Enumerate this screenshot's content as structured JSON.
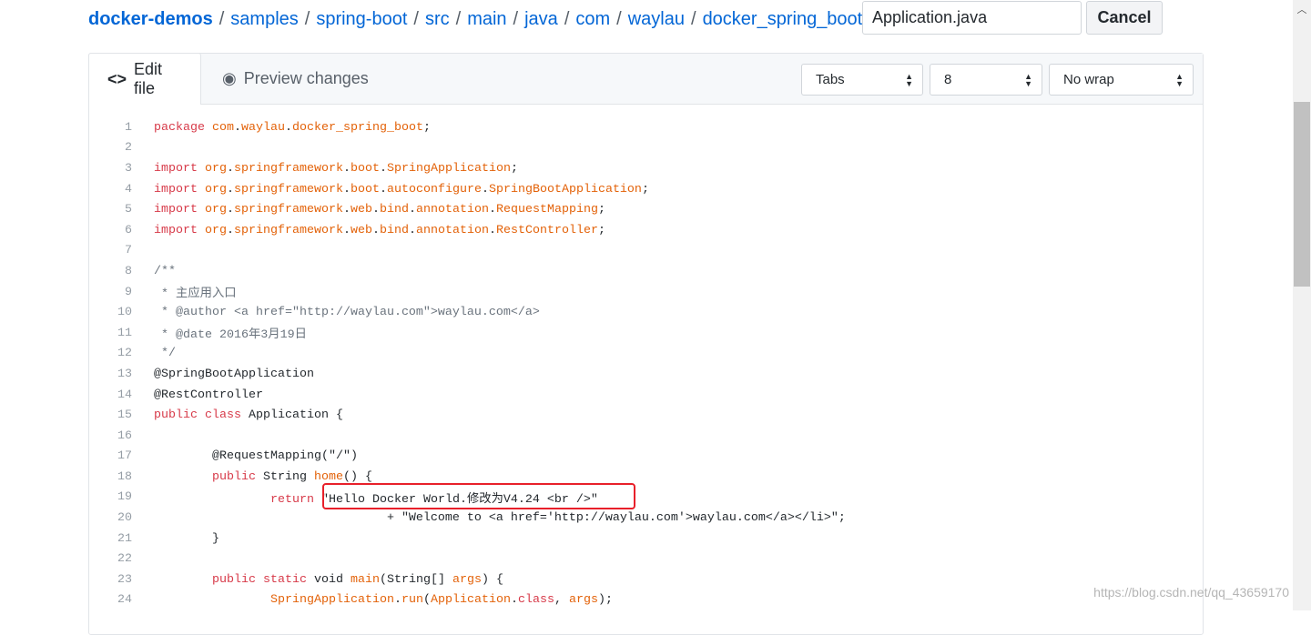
{
  "breadcrumb": [
    "docker-demos",
    "samples",
    "spring-boot",
    "src",
    "main",
    "java",
    "com",
    "waylau",
    "docker_spring_boot"
  ],
  "separator": "/",
  "filename_input": {
    "value": "Application.java"
  },
  "cancel_label": "Cancel",
  "tabs": [
    {
      "label": "Edit file",
      "icon": "code-icon",
      "glyph": "<>",
      "active": true
    },
    {
      "label": "Preview changes",
      "icon": "eye-icon",
      "glyph": "👁",
      "active": false
    }
  ],
  "selects": {
    "indent_mode": "Tabs",
    "indent_size": "8",
    "wrap_mode": "No wrap"
  },
  "colors": {
    "keyword": "#d73a49",
    "entity": "#e36209",
    "comment": "#6a737d",
    "link": "#0366d6",
    "highlight_box": "#e8202a"
  },
  "code_lines": [
    [
      [
        "package ",
        "k"
      ],
      [
        "com",
        "o"
      ],
      [
        ".",
        "t"
      ],
      [
        "waylau",
        "o"
      ],
      [
        ".",
        "t"
      ],
      [
        "docker_spring_boot",
        "o"
      ],
      [
        ";",
        "t"
      ]
    ],
    [],
    [
      [
        "import ",
        "k"
      ],
      [
        "org",
        "o"
      ],
      [
        ".",
        "t"
      ],
      [
        "springframework",
        "o"
      ],
      [
        ".",
        "t"
      ],
      [
        "boot",
        "o"
      ],
      [
        ".",
        "t"
      ],
      [
        "SpringApplication",
        "o"
      ],
      [
        ";",
        "t"
      ]
    ],
    [
      [
        "import ",
        "k"
      ],
      [
        "org",
        "o"
      ],
      [
        ".",
        "t"
      ],
      [
        "springframework",
        "o"
      ],
      [
        ".",
        "t"
      ],
      [
        "boot",
        "o"
      ],
      [
        ".",
        "t"
      ],
      [
        "autoconfigure",
        "o"
      ],
      [
        ".",
        "t"
      ],
      [
        "SpringBootApplication",
        "o"
      ],
      [
        ";",
        "t"
      ]
    ],
    [
      [
        "import ",
        "k"
      ],
      [
        "org",
        "o"
      ],
      [
        ".",
        "t"
      ],
      [
        "springframework",
        "o"
      ],
      [
        ".",
        "t"
      ],
      [
        "web",
        "o"
      ],
      [
        ".",
        "t"
      ],
      [
        "bind",
        "o"
      ],
      [
        ".",
        "t"
      ],
      [
        "annotation",
        "o"
      ],
      [
        ".",
        "t"
      ],
      [
        "RequestMapping",
        "o"
      ],
      [
        ";",
        "t"
      ]
    ],
    [
      [
        "import ",
        "k"
      ],
      [
        "org",
        "o"
      ],
      [
        ".",
        "t"
      ],
      [
        "springframework",
        "o"
      ],
      [
        ".",
        "t"
      ],
      [
        "web",
        "o"
      ],
      [
        ".",
        "t"
      ],
      [
        "bind",
        "o"
      ],
      [
        ".",
        "t"
      ],
      [
        "annotation",
        "o"
      ],
      [
        ".",
        "t"
      ],
      [
        "RestController",
        "o"
      ],
      [
        ";",
        "t"
      ]
    ],
    [],
    [
      [
        "/**",
        "c"
      ]
    ],
    [
      [
        " * 主应用入口",
        "c"
      ]
    ],
    [
      [
        " * @author <a href=\"http://waylau.com\">waylau.com</a>",
        "c"
      ]
    ],
    [
      [
        " * @date 2016年3月19日",
        "c"
      ]
    ],
    [
      [
        " */",
        "c"
      ]
    ],
    [
      [
        "@SpringBootApplication",
        "t"
      ]
    ],
    [
      [
        "@RestController",
        "t"
      ]
    ],
    [
      [
        "public class ",
        "k"
      ],
      [
        "Application {",
        "t"
      ]
    ],
    [],
    [
      [
        "        @RequestMapping(\"/\")",
        "t"
      ]
    ],
    [
      [
        "        ",
        "t"
      ],
      [
        "public ",
        "k"
      ],
      [
        "String ",
        "t"
      ],
      [
        "home",
        "o"
      ],
      [
        "() {",
        "t"
      ]
    ],
    [
      [
        "                ",
        "t"
      ],
      [
        "return ",
        "k"
      ],
      [
        "\"Hello Docker World.修改为V4.24 <br />\"",
        "t"
      ]
    ],
    [
      [
        "                                + \"Welcome to <a href='http://waylau.com'>waylau.com</a></li>\";",
        "t"
      ]
    ],
    [
      [
        "        }",
        "t"
      ]
    ],
    [],
    [
      [
        "        ",
        "t"
      ],
      [
        "public static ",
        "k"
      ],
      [
        "void ",
        "t"
      ],
      [
        "main",
        "o"
      ],
      [
        "(String[] ",
        "t"
      ],
      [
        "args",
        "o"
      ],
      [
        ") {",
        "t"
      ]
    ],
    [
      [
        "                ",
        "t"
      ],
      [
        "SpringApplication",
        "o"
      ],
      [
        ".",
        "t"
      ],
      [
        "run",
        "o"
      ],
      [
        "(",
        "t"
      ],
      [
        "Application",
        "o"
      ],
      [
        ".",
        "t"
      ],
      [
        "class",
        "k"
      ],
      [
        ", ",
        "t"
      ],
      [
        "args",
        "o"
      ],
      [
        ");",
        "t"
      ]
    ]
  ],
  "watermark": "https://blog.csdn.net/qq_43659170"
}
